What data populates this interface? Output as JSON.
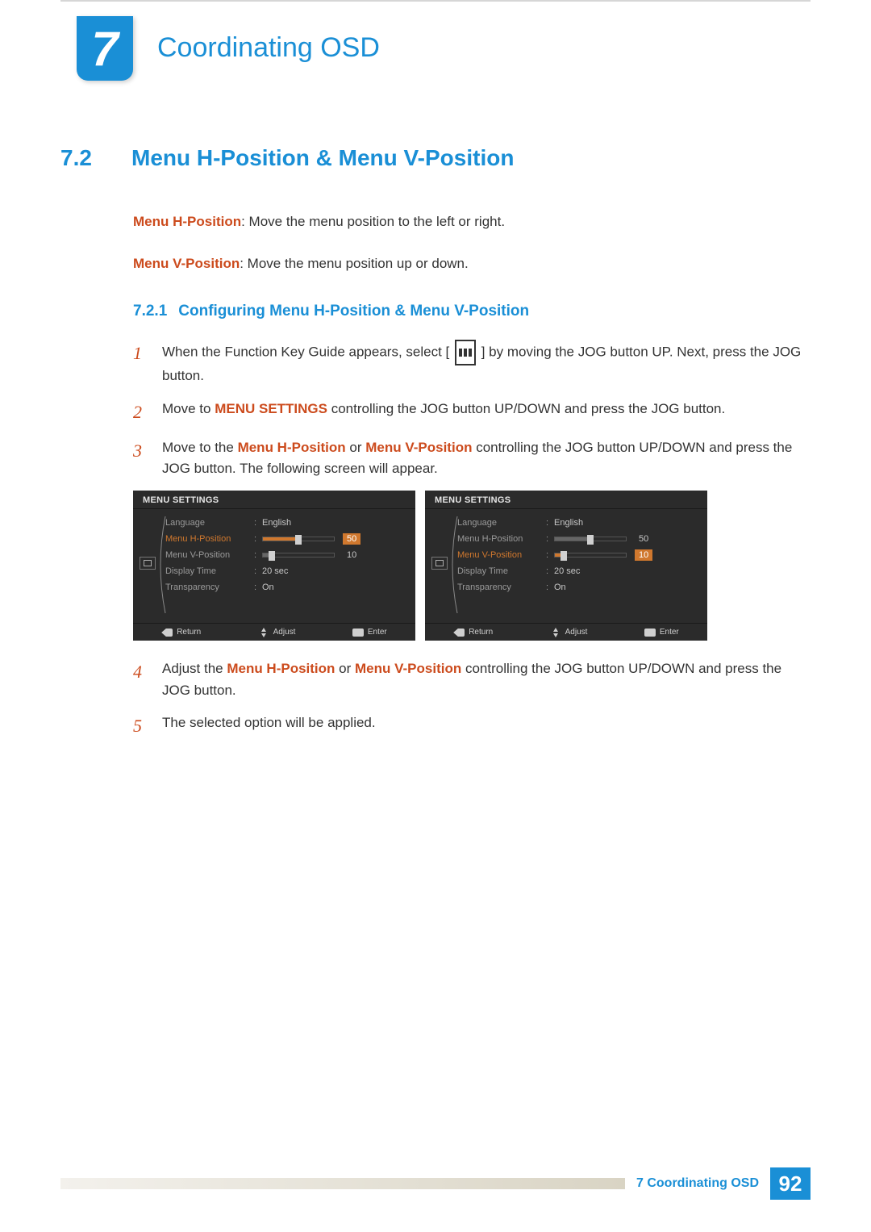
{
  "chapter": {
    "number": "7",
    "title": "Coordinating OSD"
  },
  "section": {
    "number": "7.2",
    "title": "Menu H-Position & Menu V-Position"
  },
  "definitions": [
    {
      "term": "Menu H-Position",
      "desc": ": Move the menu position to the left or right."
    },
    {
      "term": "Menu V-Position",
      "desc": ": Move the menu position up or down."
    }
  ],
  "subsection": {
    "number": "7.2.1",
    "title": "Configuring Menu H-Position & Menu V-Position"
  },
  "steps": {
    "s1a": "When the Function Key Guide appears, select [",
    "s1b": "] by moving the JOG button UP. Next, press the JOG button.",
    "s2a": "Move to ",
    "s2b": "MENU SETTINGS",
    "s2c": " controlling the JOG button UP/DOWN and press the JOG button.",
    "s3a": "Move to the ",
    "s3b": "Menu H-Position",
    "s3c": " or ",
    "s3d": "Menu V-Position",
    "s3e": " controlling the JOG button UP/DOWN and press the JOG button. The following screen will appear.",
    "s4a": "Adjust the ",
    "s4b": "Menu H-Position",
    "s4c": " or ",
    "s4d": "Menu V-Position",
    "s4e": " controlling the JOG button UP/DOWN and press the JOG button.",
    "s5": "The selected option will be applied."
  },
  "step_numbers": {
    "n1": "1",
    "n2": "2",
    "n3": "3",
    "n4": "4",
    "n5": "5"
  },
  "osd": {
    "title": "MENU SETTINGS",
    "rows": {
      "language": {
        "label": "Language",
        "value": "English"
      },
      "hpos": {
        "label": "Menu H-Position",
        "value": "50"
      },
      "vpos": {
        "label": "Menu V-Position",
        "value": "10"
      },
      "display_time": {
        "label": "Display Time",
        "value": "20 sec"
      },
      "transparency": {
        "label": "Transparency",
        "value": "On"
      }
    },
    "footer": {
      "return": "Return",
      "adjust": "Adjust",
      "enter": "Enter"
    }
  },
  "footer": {
    "label": "7 Coordinating OSD",
    "page": "92"
  }
}
